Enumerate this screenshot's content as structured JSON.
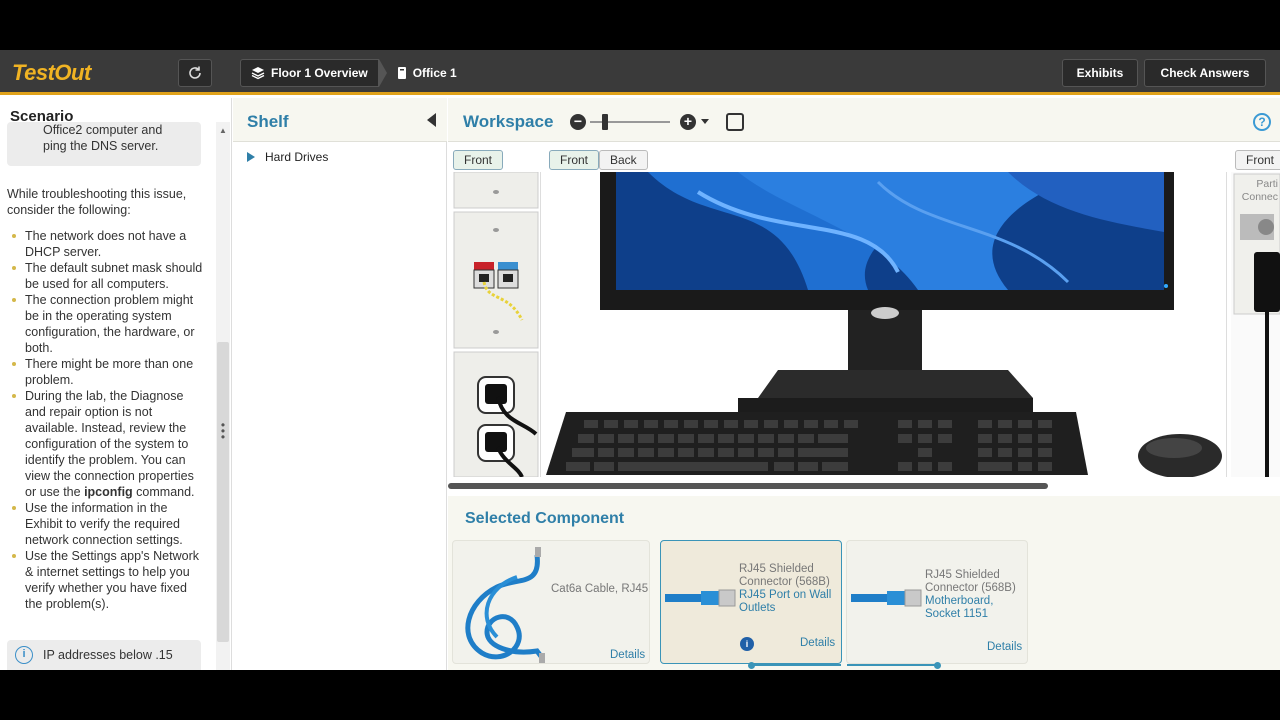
{
  "topbar": {
    "logo": "TestOut",
    "breadcrumbs": [
      "Floor 1 Overview",
      "Office 1"
    ],
    "exhibits_label": "Exhibits",
    "check_label": "Check Answers"
  },
  "scenario": {
    "title": "Scenario",
    "box_text_1": "Office2 computer and",
    "box_text_2": "ping the DNS server.",
    "intro": "While troubleshooting this issue, consider the following:",
    "items": [
      "The network does not have a DHCP server.",
      "The default subnet mask should be used for all computers.",
      "The connection problem might be in the operating system configuration, the hardware, or both.",
      "There might be more than one problem."
    ],
    "item_diag_pre": "During the lab, the Diagnose and repair option is not available. Instead, review the configuration of the system to identify the problem. You can view the connection properties or use the ",
    "item_diag_cmd": "ipconfig",
    "item_diag_post": " command.",
    "items_after": [
      "Use the information in the Exhibit to verify the required network connection settings.",
      "Use the Settings app's Network & internet settings to help you verify whether you have fixed the problem(s)."
    ],
    "ip_note": "IP addresses below .15"
  },
  "shelf": {
    "title": "Shelf",
    "items": [
      "Hard Drives"
    ]
  },
  "workspace": {
    "title": "Workspace",
    "left_view": "Front",
    "center_views": [
      "Front",
      "Back"
    ],
    "right_view": "Front",
    "right_partial_label_1": "Parti",
    "right_partial_label_2": "Connec"
  },
  "selected_component": {
    "title": "Selected Component",
    "cards": [
      {
        "label": "Cat6a Cable, RJ45",
        "sub": "",
        "details": "Details"
      },
      {
        "label": "RJ45 Shielded Connector (568B)",
        "sub": "RJ45 Port on Wall Outlets",
        "details": "Details"
      },
      {
        "label": "RJ45 Shielded Connector (568B)",
        "sub": "Motherboard, Socket 1151",
        "details": "Details"
      }
    ]
  },
  "colors": {
    "accent": "#2f7fa8",
    "logo": "#f0b323",
    "topbar": "#3a3a3a"
  }
}
